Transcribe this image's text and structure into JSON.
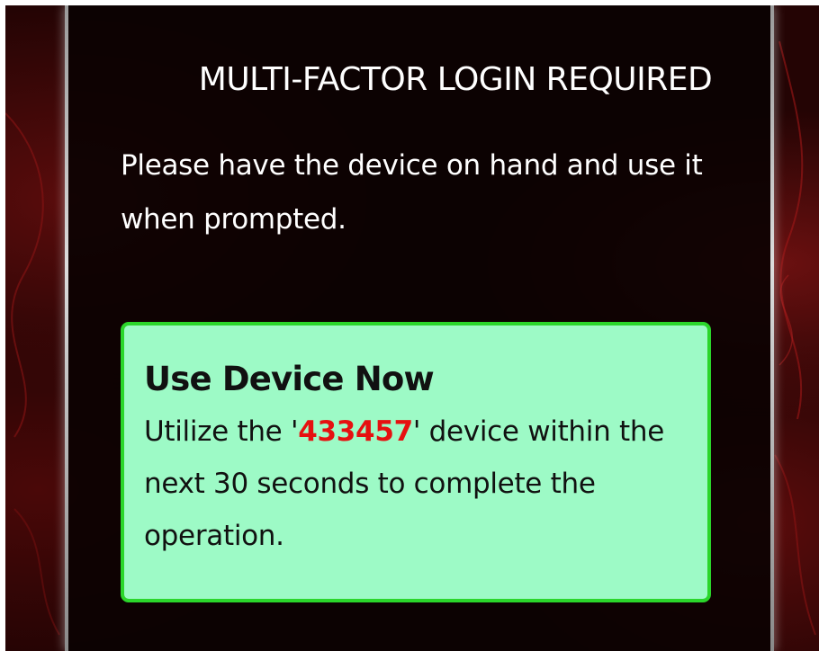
{
  "page": {
    "title": "MULTI-FACTOR LOGIN REQUIRED",
    "subtitle": "Please have the device on hand and use it when prompted."
  },
  "alert": {
    "heading": "Use Device Now",
    "body_prefix": "Utilize the '",
    "device_code": "433457",
    "body_suffix": "' device within the next 30 seconds to complete the operation."
  },
  "colors": {
    "background": "#240404",
    "panel": "#0a0202",
    "alert_background": "#9dfac6",
    "alert_border": "#2bd62b",
    "device_code": "#e61010"
  }
}
